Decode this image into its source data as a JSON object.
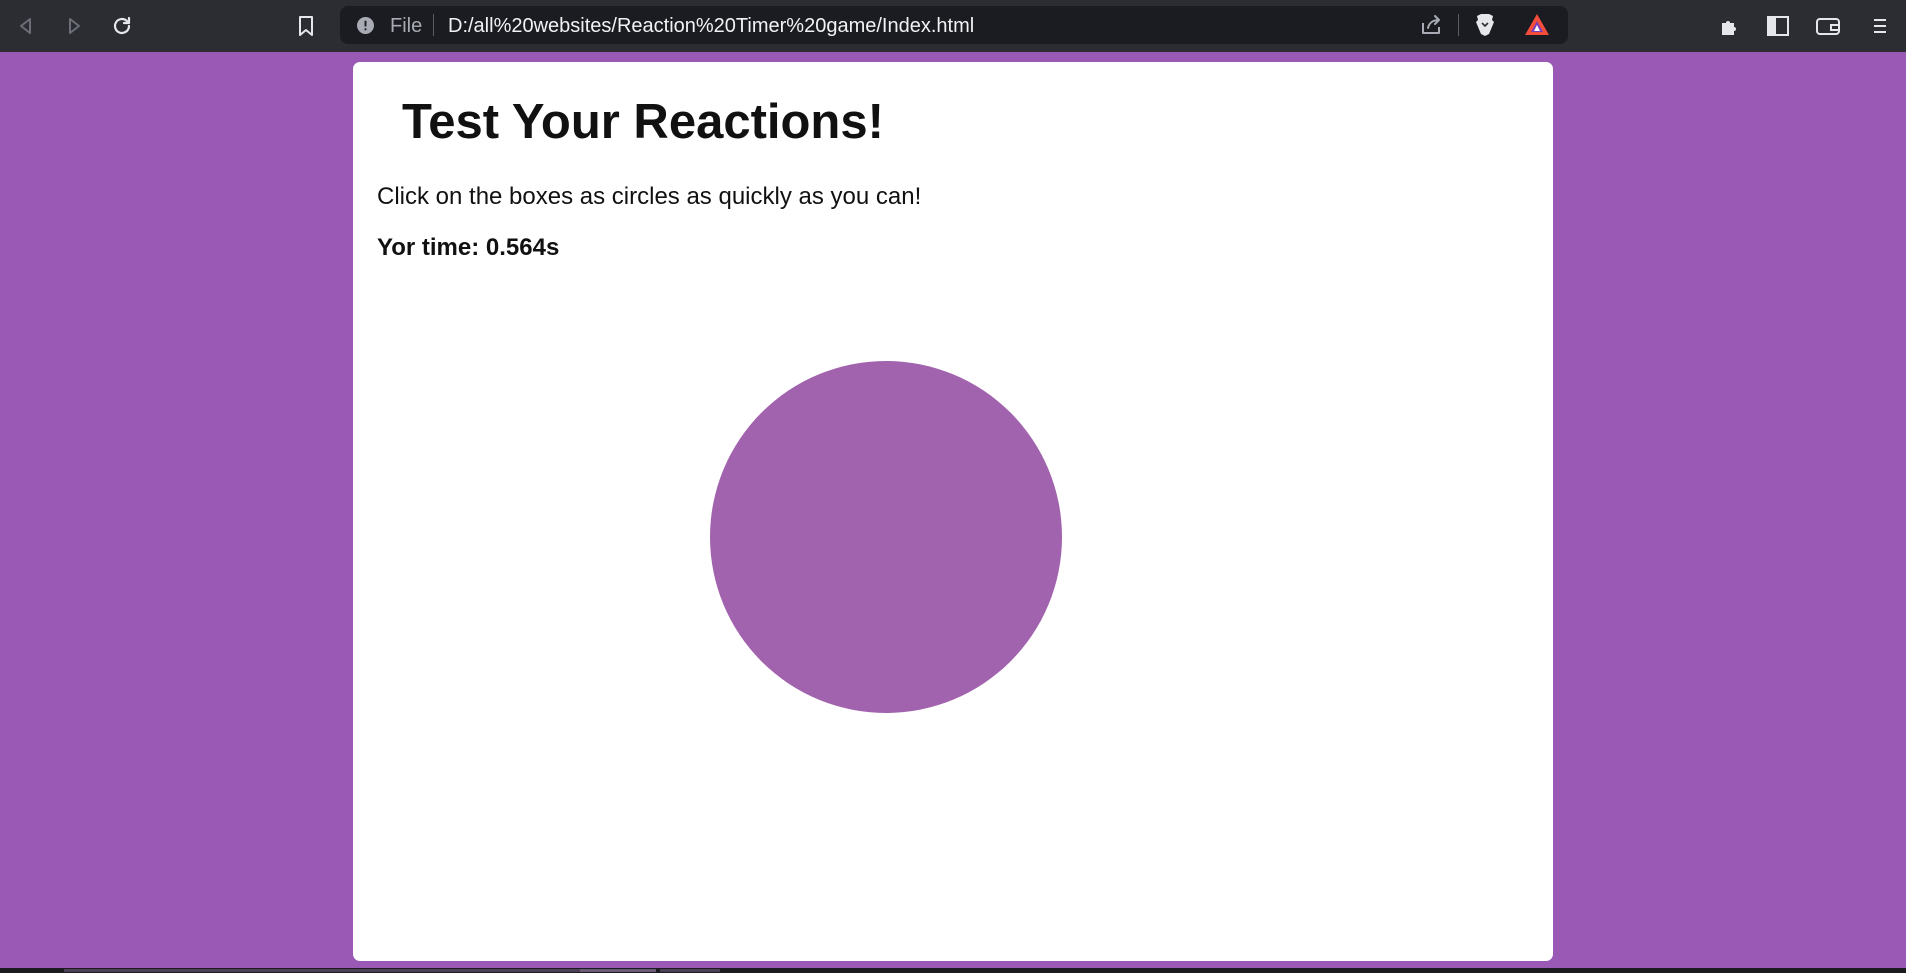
{
  "browser": {
    "scheme_label": "File",
    "url": "D:/all%20websites/Reaction%20Timer%20game/Index.html",
    "icons": [
      "back-icon",
      "forward-icon",
      "reload-icon",
      "bookmark-icon",
      "info-icon",
      "share-icon",
      "brave-shields-icon",
      "brave-rewards-icon",
      "extensions-icon",
      "sidebar-icon",
      "wallet-icon",
      "menu-icon"
    ]
  },
  "page": {
    "heading": "Test Your Reactions!",
    "instructions": "Click on the boxes as circles as quickly as you can!",
    "time_label": "Yor time: 0.564s"
  },
  "colors": {
    "background": "#9b59b6",
    "card": "#ffffff",
    "target": "#a263ae",
    "toolbar": "#2b2d33"
  }
}
